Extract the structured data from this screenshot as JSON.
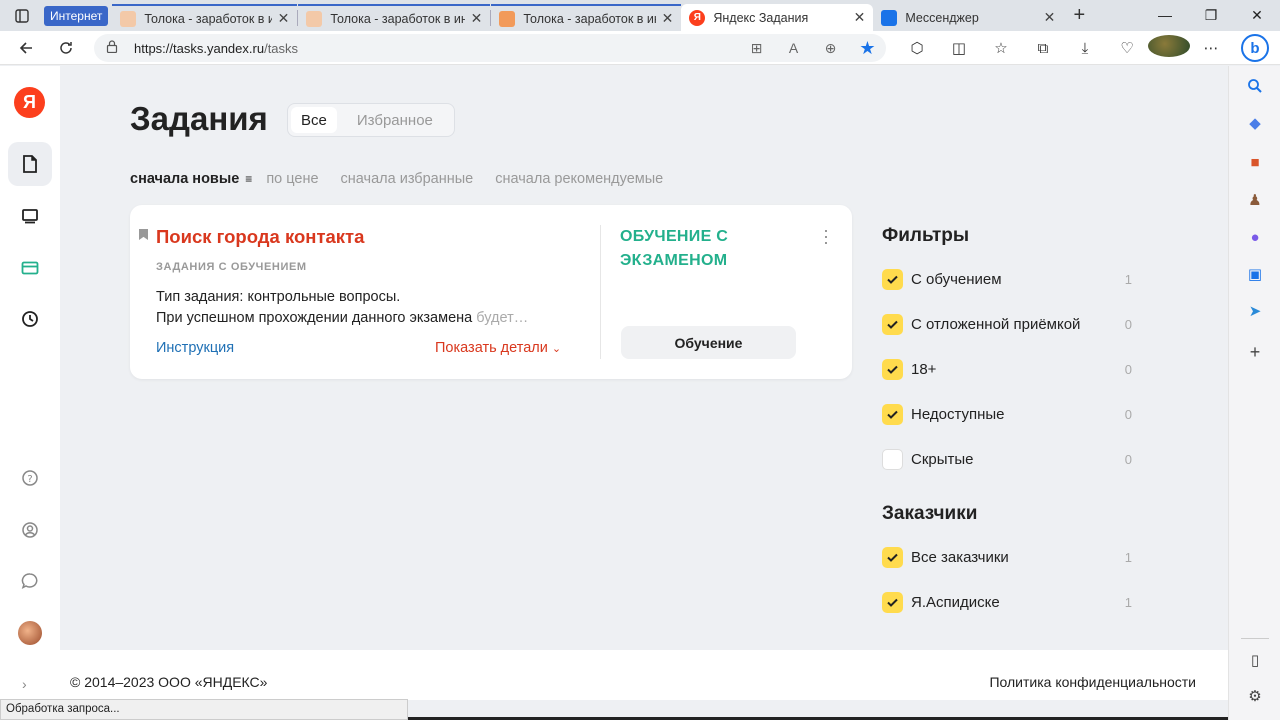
{
  "browser": {
    "tab_group_label": "Интернет",
    "tabs": [
      {
        "title": "Толока - заработок в инте",
        "color": "#f3c9a8",
        "grouped": true
      },
      {
        "title": "Толока - заработок в инте",
        "color": "#f3c9a8",
        "grouped": true
      },
      {
        "title": "Толока - заработок в инте",
        "color": "#f29a5a",
        "grouped": true
      },
      {
        "title": "Яндекс Задания",
        "color": "#fc3f1d",
        "active": true
      },
      {
        "title": "Мессенджер",
        "color": "#1a73e8"
      }
    ],
    "tab_close_glyph": "✕",
    "new_tab_glyph": "+",
    "window_controls": {
      "minimize": "—",
      "maximize": "❐",
      "close": "✕"
    },
    "address": {
      "host": "https://tasks.yandex.ru",
      "path": "/tasks"
    }
  },
  "sidebar": {
    "logo": "Я",
    "items": [
      "tasks-icon",
      "monitor-icon",
      "wallet-icon",
      "history-icon",
      "help-icon",
      "profile-icon",
      "chat-icon"
    ]
  },
  "main": {
    "title": "Задания",
    "segments": [
      "Все",
      "Избранное"
    ],
    "sort": {
      "active": "сначала новые",
      "options": [
        "по цене",
        "сначала избранные",
        "сначала рекомендуемые"
      ]
    },
    "card": {
      "title": "Поиск города контакта",
      "subtitle": "ЗАДАНИЯ С ОБУЧЕНИЕМ",
      "desc_line1": "Тип задания: контрольные вопросы.",
      "desc_line2": "При успешном прохождении данного экзамена ",
      "desc_fade": "будет…",
      "instruction_link": "Инструкция",
      "details_link": "Показать детали",
      "type_label": "ОБУЧЕНИЕ С ЭКЗАМЕНОМ",
      "button": "Обучение"
    }
  },
  "filters": {
    "heading": "Фильтры",
    "items": [
      {
        "label": "С обучением",
        "count": "1",
        "checked": true
      },
      {
        "label": "С отложенной приёмкой",
        "count": "0",
        "checked": true
      },
      {
        "label": "18+",
        "count": "0",
        "checked": true
      },
      {
        "label": "Недоступные",
        "count": "0",
        "checked": true
      },
      {
        "label": "Скрытые",
        "count": "0",
        "checked": false
      }
    ]
  },
  "customers": {
    "heading": "Заказчики",
    "items": [
      {
        "label": "Все заказчики",
        "count": "1",
        "checked": true
      },
      {
        "label": "Я.Аспидиске",
        "count": "1",
        "checked": true
      }
    ]
  },
  "footer": {
    "copyright": "© 2014–2023 ООО «ЯНДЕКС»",
    "privacy": "Политика конфиденциальности"
  },
  "statusbar": "Обработка запроса...",
  "colors": {
    "accent_red": "#d9381e",
    "accent_green": "#23b08c",
    "checkbox_yellow": "#ffdb4d",
    "link_blue": "#1f70b5"
  }
}
